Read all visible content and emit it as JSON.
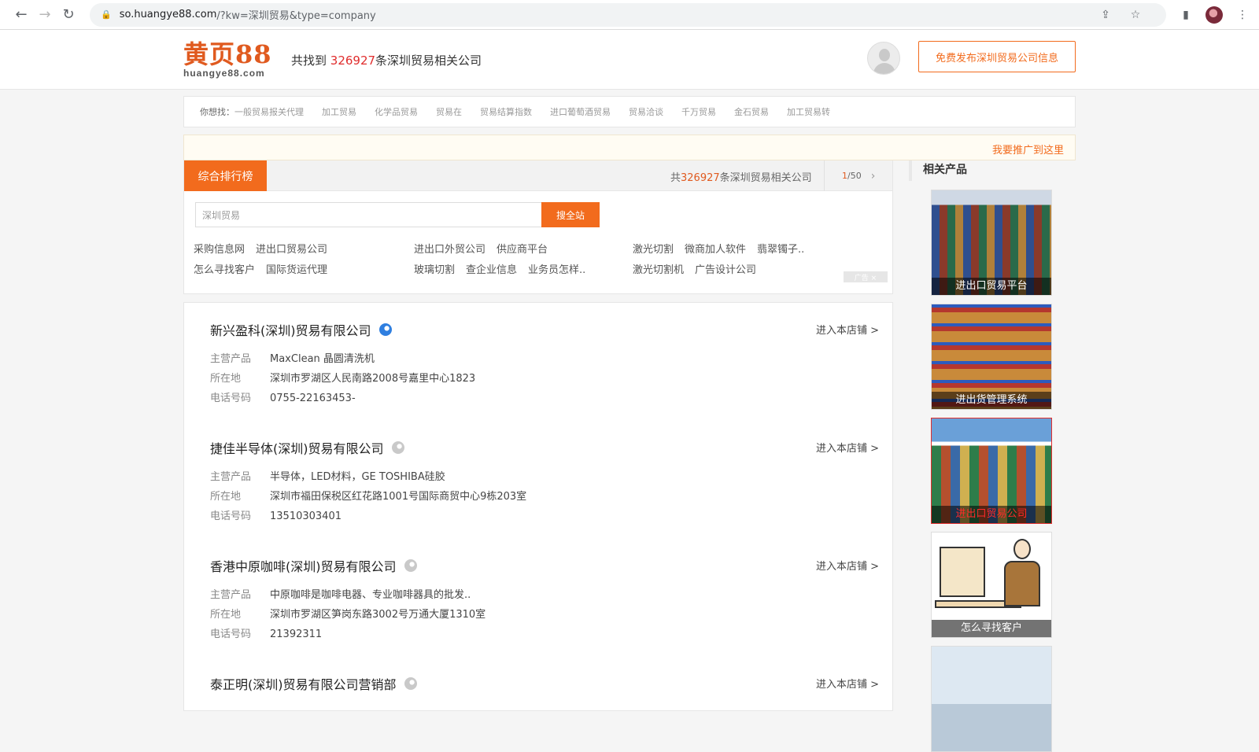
{
  "browser": {
    "url_domain": "so.huangye88.com",
    "url_rest": "/?kw=深圳贸易&type=company"
  },
  "header": {
    "logo_main": "黄页88",
    "logo_sub": "huangye88.com",
    "found_prefix": "共找到 ",
    "found_count": "326927",
    "found_suffix": "条深圳贸易相关公司",
    "publish_button": "免费发布深圳贸易公司信息"
  },
  "wish": {
    "label": "你想找：",
    "items": [
      "一般贸易报关代理",
      "加工贸易",
      "化学品贸易",
      "贸易在",
      "贸易结算指数",
      "进口葡萄酒贸易",
      "贸易洽谈",
      "千万贸易",
      "金石贸易",
      "加工贸易转"
    ]
  },
  "promo": {
    "link": "我要推广到这里"
  },
  "ranking": {
    "tab": "综合排行榜",
    "total_prefix": "共",
    "total_count": "326927",
    "total_suffix": "条深圳贸易相关公司",
    "page_current": "1",
    "page_total": "/50",
    "next": "›"
  },
  "search": {
    "placeholder": "深圳贸易",
    "button": "搜全站"
  },
  "keywords": {
    "col1": [
      [
        "采购信息网",
        "进出口贸易公司"
      ],
      [
        "怎么寻找客户",
        "国际货运代理"
      ]
    ],
    "col2": [
      [
        "进出口外贸公司",
        "供应商平台"
      ],
      [
        "玻璃切割",
        "查企业信息",
        "业务员怎样.."
      ]
    ],
    "col3": [
      [
        "激光切割",
        "微商加人软件",
        "翡翠镯子.."
      ],
      [
        "激光切割机",
        "广告设计公司"
      ]
    ],
    "ad_tag": "广告 ×"
  },
  "companies": [
    {
      "name": "新兴盈科(深圳)贸易有限公司",
      "cert": "active",
      "shop": "进入本店铺 >",
      "product_label": "主营产品",
      "product": "MaxClean 晶圆清洗机",
      "address_label": "所在地",
      "address": "深圳市罗湖区人民南路2008号嘉里中心1823",
      "phone_label": "电话号码",
      "phone": "0755-22163453-"
    },
    {
      "name": "捷佳半导体(深圳)贸易有限公司",
      "cert": "gray",
      "shop": "进入本店铺 >",
      "product_label": "主营产品",
      "product": "半导体，LED材料，GE TOSHIBA硅胶",
      "address_label": "所在地",
      "address": "深圳市福田保税区红花路1001号国际商贸中心9栋203室",
      "phone_label": "电话号码",
      "phone": "13510303401"
    },
    {
      "name": "香港中原咖啡(深圳)贸易有限公司",
      "cert": "gray",
      "shop": "进入本店铺 >",
      "product_label": "主营产品",
      "product": "中原咖啡是咖啡电器、专业咖啡器具的批发..",
      "address_label": "所在地",
      "address": "深圳市罗湖区笋岗东路3002号万通大厦1310室",
      "phone_label": "电话号码",
      "phone": "21392311"
    },
    {
      "name": "泰正明(深圳)贸易有限公司营销部",
      "cert": "gray",
      "shop": "进入本店铺 >"
    }
  ],
  "side": {
    "heading": "相关产品",
    "products": [
      {
        "caption": "进出口贸易平台"
      },
      {
        "caption": "进出货管理系统"
      },
      {
        "caption": "进出口贸易公司"
      },
      {
        "caption": "怎么寻找客户"
      }
    ]
  }
}
